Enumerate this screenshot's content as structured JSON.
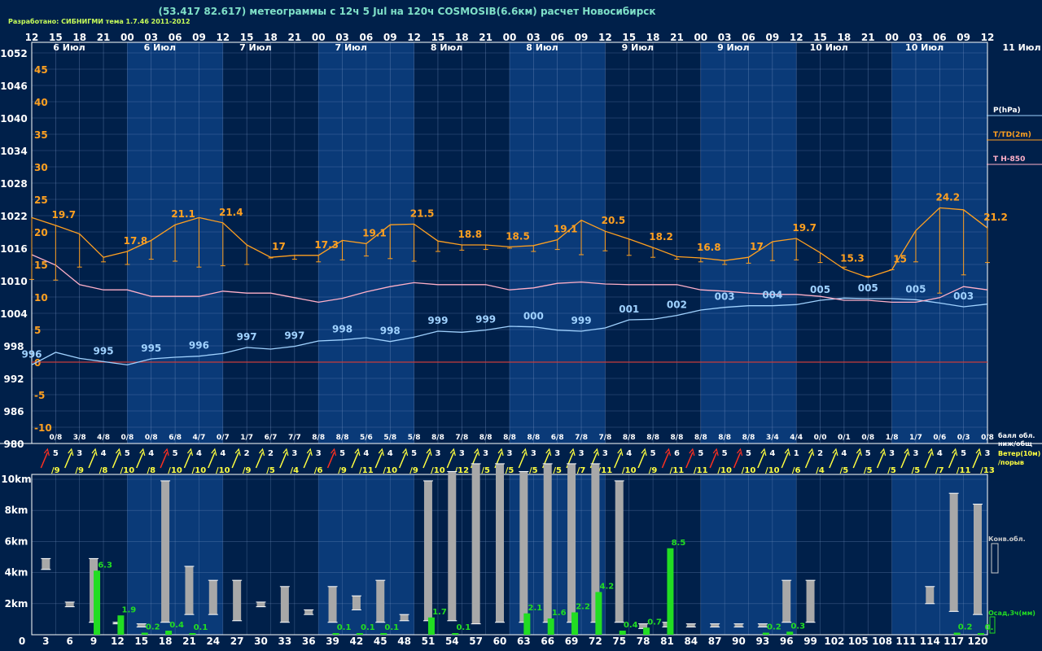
{
  "header": {
    "title": "(53.417 82.617) метеограммы с  12ч 5 Jul на 120ч COSMOSIB(6.6км) расчет Новосибирск",
    "credit": "Разработано: СИБНИГМИ тема 1.7.46 2011-2012"
  },
  "colors": {
    "background": "#00204a",
    "day_band": "#0a3a78",
    "grid": "#7a96c4",
    "pressure": "#a0d2ff",
    "temperature": "#ffa020",
    "t850": "#ffb0c8",
    "zero_line": "#c83c3c",
    "cloud_bar": "#a8a8a8",
    "precip": "#22dd22",
    "wind_yellow": "#ffff40",
    "wind_red": "#ff3020"
  },
  "top_hours": [
    "12",
    "15",
    "18",
    "21",
    "00",
    "03",
    "06",
    "09",
    "12",
    "15",
    "18",
    "21",
    "00",
    "03",
    "06",
    "09",
    "12",
    "15",
    "18",
    "21",
    "00",
    "03",
    "06",
    "09",
    "12",
    "15",
    "18",
    "21",
    "00",
    "03",
    "06",
    "09",
    "12",
    "15",
    "18",
    "21",
    "00",
    "03",
    "06",
    "09",
    "12"
  ],
  "day_labels": [
    "6 Июл",
    "6 Июл",
    "7 Июл",
    "7 Июл",
    "8 Июл",
    "8 Июл",
    "9 Июл",
    "9 Июл",
    "10 Июл",
    "10 Июл",
    "11 Июл"
  ],
  "left_axis": {
    "pressure_ticks": [
      "1052",
      "1046",
      "1040",
      "1034",
      "1028",
      "1022",
      "1016",
      "1010",
      "1004",
      "998",
      "992",
      "986",
      "980"
    ],
    "temperature_ticks": [
      "45",
      "40",
      "35",
      "30",
      "25",
      "20",
      "15",
      "10",
      "5",
      "0",
      "-5",
      "-10"
    ]
  },
  "legend": {
    "pressure": "P(hPa)",
    "temperature": "T/TD(2m)",
    "t850": "T H-850",
    "cloud_cover": "балл обл.\nниж/общ",
    "wind": "Ветер(10м)\n/порыв",
    "convective": "Конв.обл.",
    "precip": "Осад,3ч(мм)"
  },
  "cloud_amounts": [
    "0/8",
    "3/8",
    "4/8",
    "0/8",
    "0/8",
    "6/8",
    "4/7",
    "0/7",
    "1/7",
    "6/7",
    "7/7",
    "8/8",
    "8/8",
    "5/6",
    "5/8",
    "5/8",
    "8/8",
    "7/8",
    "8/8",
    "8/8",
    "8/8",
    "6/8",
    "7/8",
    "7/8",
    "8/8",
    "8/8",
    "8/8",
    "8/8",
    "8/8",
    "8/8",
    "3/4",
    "4/4",
    "0/0",
    "0/1",
    "0/8",
    "1/8",
    "1/7",
    "0/6",
    "0/3",
    "0/8"
  ],
  "wind": {
    "speeds": [
      "5",
      "3",
      "4",
      "5",
      "4",
      "5",
      "4",
      "4",
      "2",
      "2",
      "3",
      "3",
      "5",
      "4",
      "4",
      "5",
      "3",
      "3",
      "3",
      "3",
      "3",
      "3",
      "3",
      "3",
      "4",
      "5",
      "6",
      "5",
      "5",
      "5",
      "4",
      "1",
      "2",
      "4",
      "5",
      "3",
      "3",
      "4",
      "5",
      "3"
    ],
    "gusts": [
      "/9",
      "/9",
      "/8",
      "/10",
      "/8",
      "/10",
      "/10",
      "/10",
      "/9",
      "/5",
      "/4",
      "/6",
      "/9",
      "/11",
      "/10",
      "/9",
      "/10",
      "/12",
      "/5",
      "/5",
      "/5",
      "/5",
      "/7",
      "/11",
      "/10",
      "/9",
      "/11",
      "/11",
      "/10",
      "/10",
      "/10",
      "/6",
      "/4",
      "/5",
      "/5",
      "/5",
      "/5",
      "/7",
      "/11",
      "/13"
    ],
    "red": [
      true,
      false,
      false,
      false,
      false,
      true,
      false,
      false,
      false,
      false,
      false,
      false,
      true,
      false,
      false,
      false,
      false,
      false,
      false,
      false,
      false,
      false,
      false,
      false,
      false,
      false,
      true,
      true,
      true,
      true,
      false,
      false,
      false,
      false,
      false,
      false,
      false,
      false,
      false,
      false
    ]
  },
  "bottom_axis": {
    "height_ticks": [
      "10km",
      "8km",
      "6km",
      "4km",
      "2km"
    ],
    "hours": [
      "0",
      "3",
      "6",
      "9",
      "12",
      "15",
      "18",
      "21",
      "24",
      "27",
      "30",
      "33",
      "36",
      "39",
      "42",
      "45",
      "48",
      "51",
      "54",
      "57",
      "60",
      "63",
      "66",
      "69",
      "72",
      "75",
      "78",
      "81",
      "84",
      "87",
      "90",
      "93",
      "96",
      "99",
      "102",
      "105",
      "108",
      "111",
      "114",
      "117",
      "120"
    ]
  },
  "chart_data": [
    {
      "type": "line",
      "title": "",
      "xlabel": "",
      "ylabel": "P(hPa)",
      "x": [
        0,
        3,
        6,
        9,
        12,
        15,
        18,
        21,
        24,
        27,
        30,
        33,
        36,
        39,
        42,
        45,
        48,
        51,
        54,
        57,
        60,
        63,
        66,
        69,
        72,
        75,
        78,
        81,
        84,
        87,
        90,
        93,
        96,
        99,
        102,
        105,
        108,
        111,
        114,
        117,
        120
      ],
      "ylim": [
        980,
        1055
      ],
      "series": [
        {
          "name": "P(hPa)",
          "values": [
            994.5,
            996.8,
            995.7,
            995.1,
            994.5,
            995.6,
            995.9,
            996.1,
            996.6,
            997.7,
            997.4,
            997.9,
            998.9,
            999.1,
            999.5,
            998.8,
            999.6,
            1000.7,
            1000.5,
            1000.9,
            1001.6,
            1001.5,
            1000.9,
            1000.7,
            1001.3,
            1002.8,
            1002.9,
            1003.6,
            1004.6,
            1005.1,
            1005.4,
            1005.4,
            1005.6,
            1006.4,
            1006.8,
            1006.7,
            1006.7,
            1006.5,
            1005.9,
            1005.2,
            1005.7
          ],
          "labels": {
            "1": "996",
            "4": "995",
            "6": "995",
            "8": "996",
            "10": "997",
            "12": "997",
            "14": "998",
            "16": "998",
            "18": "999",
            "20": "999",
            "22": "000",
            "24": "999",
            "26": "001",
            "28": "002",
            "30": "003",
            "32": "004",
            "34": "005",
            "36": "005",
            "38": "005",
            "40": "003"
          }
        }
      ]
    },
    {
      "type": "line",
      "title": "",
      "xlabel": "",
      "ylabel": "T/TD(2m)",
      "x": [
        0,
        3,
        6,
        9,
        12,
        15,
        18,
        21,
        24,
        27,
        30,
        33,
        36,
        39,
        42,
        45,
        48,
        51,
        54,
        57,
        60,
        63,
        66,
        69,
        72,
        75,
        78,
        81,
        84,
        87,
        90,
        93,
        96,
        99,
        102,
        105,
        108,
        111,
        114,
        117,
        120
      ],
      "ylim": [
        -12,
        47
      ],
      "series": [
        {
          "name": "T(2m)",
          "values": [
            22.2,
            21.0,
            19.7,
            16.1,
            17.0,
            18.7,
            21.1,
            22.2,
            21.4,
            18.0,
            16.1,
            16.4,
            16.4,
            18.7,
            18.2,
            21.1,
            21.2,
            18.6,
            18.0,
            18.0,
            17.7,
            17.9,
            18.8,
            21.8,
            20.1,
            18.9,
            17.6,
            16.2,
            16.0,
            15.6,
            16.1,
            18.5,
            19.0,
            16.8,
            14.3,
            13.0,
            14.2,
            20.2,
            23.7,
            23.4,
            20.6
          ],
          "labels": {
            "2": "19.7",
            "5": "17.8",
            "7": "21.1",
            "9": "21.4",
            "11": "17",
            "13": "17.3",
            "15": "19.1",
            "17": "21.5",
            "19": "18.8",
            "21": "18.5",
            "23": "19.1",
            "25": "20.5",
            "27": "18.2",
            "29": "16.8",
            "31": "17",
            "33": "19.7",
            "35": "15.3",
            "37": "15",
            "39": "24.2",
            "41": "21.2"
          }
        },
        {
          "name": "TD(2m)",
          "values": [
            12.7,
            12.6,
            14.6,
            15.4,
            15.0,
            15.8,
            15.5,
            14.6,
            14.8,
            15.0,
            16.0,
            15.8,
            15.4,
            15.7,
            16.3,
            15.9,
            15.5,
            17.0,
            17.2,
            17.3,
            17.5,
            17.0,
            17.3,
            16.5,
            17.1,
            16.4,
            16.1,
            15.8,
            15.4,
            15.0,
            15.2,
            15.6,
            15.7,
            15.3,
            14.6,
            13.2,
            14.2,
            15.4,
            10.6,
            13.4,
            15.3
          ]
        }
      ]
    },
    {
      "type": "line",
      "title": "",
      "xlabel": "",
      "ylabel": "T H-850",
      "x": [
        0,
        3,
        6,
        9,
        12,
        15,
        18,
        21,
        24,
        27,
        30,
        33,
        36,
        39,
        42,
        45,
        48,
        51,
        54,
        57,
        60,
        63,
        66,
        69,
        72,
        75,
        78,
        81,
        84,
        87,
        90,
        93,
        96,
        99,
        102,
        105,
        108,
        111,
        114,
        117,
        120
      ],
      "ylim": [
        -12,
        47
      ],
      "series": [
        {
          "name": "T H-850",
          "values": [
            16.5,
            14.9,
            11.9,
            11.1,
            11.1,
            10.1,
            10.1,
            10.1,
            10.9,
            10.6,
            10.6,
            9.9,
            9.2,
            9.8,
            10.8,
            11.6,
            12.2,
            11.9,
            11.9,
            11.9,
            11.1,
            11.4,
            12.1,
            12.3,
            12.0,
            11.9,
            11.9,
            11.9,
            11.1,
            10.9,
            10.6,
            10.4,
            10.4,
            10.1,
            9.5,
            9.5,
            9.2,
            9.2,
            9.9,
            11.6,
            11.1
          ]
        }
      ]
    },
    {
      "type": "bar",
      "title": "",
      "ylabel": "Конв.обл.",
      "x": [
        3,
        6,
        9,
        12,
        15,
        18,
        21,
        24,
        27,
        30,
        33,
        36,
        39,
        42,
        45,
        48,
        51,
        54,
        57,
        60,
        63,
        66,
        69,
        72,
        75,
        78,
        81,
        84,
        87,
        90,
        93,
        96,
        99,
        102,
        105,
        108,
        111,
        114,
        117,
        120
      ],
      "ylim": [
        0,
        11
      ],
      "units": "km",
      "cloud_base_top": [
        [
          4.2,
          4.9
        ],
        [
          1.8,
          2.1
        ],
        [
          0.8,
          4.9
        ],
        [
          0.7,
          0.8
        ],
        [
          0.5,
          0.7
        ],
        [
          0.8,
          9.9
        ],
        [
          1.3,
          4.4
        ],
        [
          1.3,
          3.5
        ],
        [
          0.9,
          3.5
        ],
        [
          1.8,
          2.1
        ],
        [
          0.8,
          3.1
        ],
        [
          1.3,
          1.6
        ],
        [
          0.8,
          3.1
        ],
        [
          1.6,
          2.5
        ],
        [
          0.8,
          3.5
        ],
        [
          0.9,
          1.3
        ],
        [
          0.9,
          9.9
        ],
        [
          0.9,
          10.5
        ],
        [
          0.7,
          11.0
        ],
        [
          0.8,
          11.0
        ],
        [
          0.8,
          10.5
        ],
        [
          0.8,
          11.0
        ],
        [
          0.8,
          11.0
        ],
        [
          0.8,
          11.0
        ],
        [
          0.8,
          9.9
        ],
        [
          0.4,
          0.7
        ],
        [
          0.5,
          0.8
        ],
        [
          0.5,
          0.7
        ],
        [
          0.5,
          0.7
        ],
        [
          0.5,
          0.7
        ],
        [
          0.5,
          0.7
        ],
        [
          0.8,
          3.5
        ],
        [
          0.8,
          3.5
        ],
        null,
        null,
        null,
        null,
        [
          2.0,
          3.1
        ],
        [
          1.5,
          9.1
        ],
        [
          1.3,
          8.4
        ]
      ]
    },
    {
      "type": "bar",
      "title": "",
      "ylabel": "Осад,3ч(мм)",
      "x": [
        3,
        6,
        9,
        12,
        15,
        18,
        21,
        24,
        27,
        30,
        33,
        36,
        39,
        42,
        45,
        48,
        51,
        54,
        57,
        60,
        63,
        66,
        69,
        72,
        75,
        78,
        81,
        84,
        87,
        90,
        93,
        96,
        99,
        102,
        105,
        108,
        111,
        114,
        117,
        120
      ],
      "values": [
        0,
        0,
        6.3,
        1.9,
        0.2,
        0.4,
        0.1,
        0,
        0,
        0,
        0,
        0,
        0.1,
        0.1,
        0.1,
        0,
        1.7,
        0.1,
        0,
        0,
        2.1,
        1.6,
        2.2,
        4.2,
        0.4,
        0.7,
        8.5,
        0,
        0,
        0,
        0.2,
        0.3,
        0,
        0,
        0,
        0,
        0,
        0,
        0.2,
        0.1
      ],
      "labels": {
        "3": "6.3",
        "4": "1.9",
        "5": "0.2",
        "6": "0.4",
        "7": "0.1",
        "13": "0.1",
        "14": "0.1",
        "15": "0.1",
        "17": "1.7",
        "18": "0.1",
        "21": "2.1",
        "22": "1.6",
        "23": "2.2",
        "24": "4.2",
        "25": "0.4",
        "26": "0.7",
        "27": "8.5",
        "31": "0.2",
        "32": "0.3",
        "39": "0.2",
        "40": "0."
      }
    }
  ]
}
